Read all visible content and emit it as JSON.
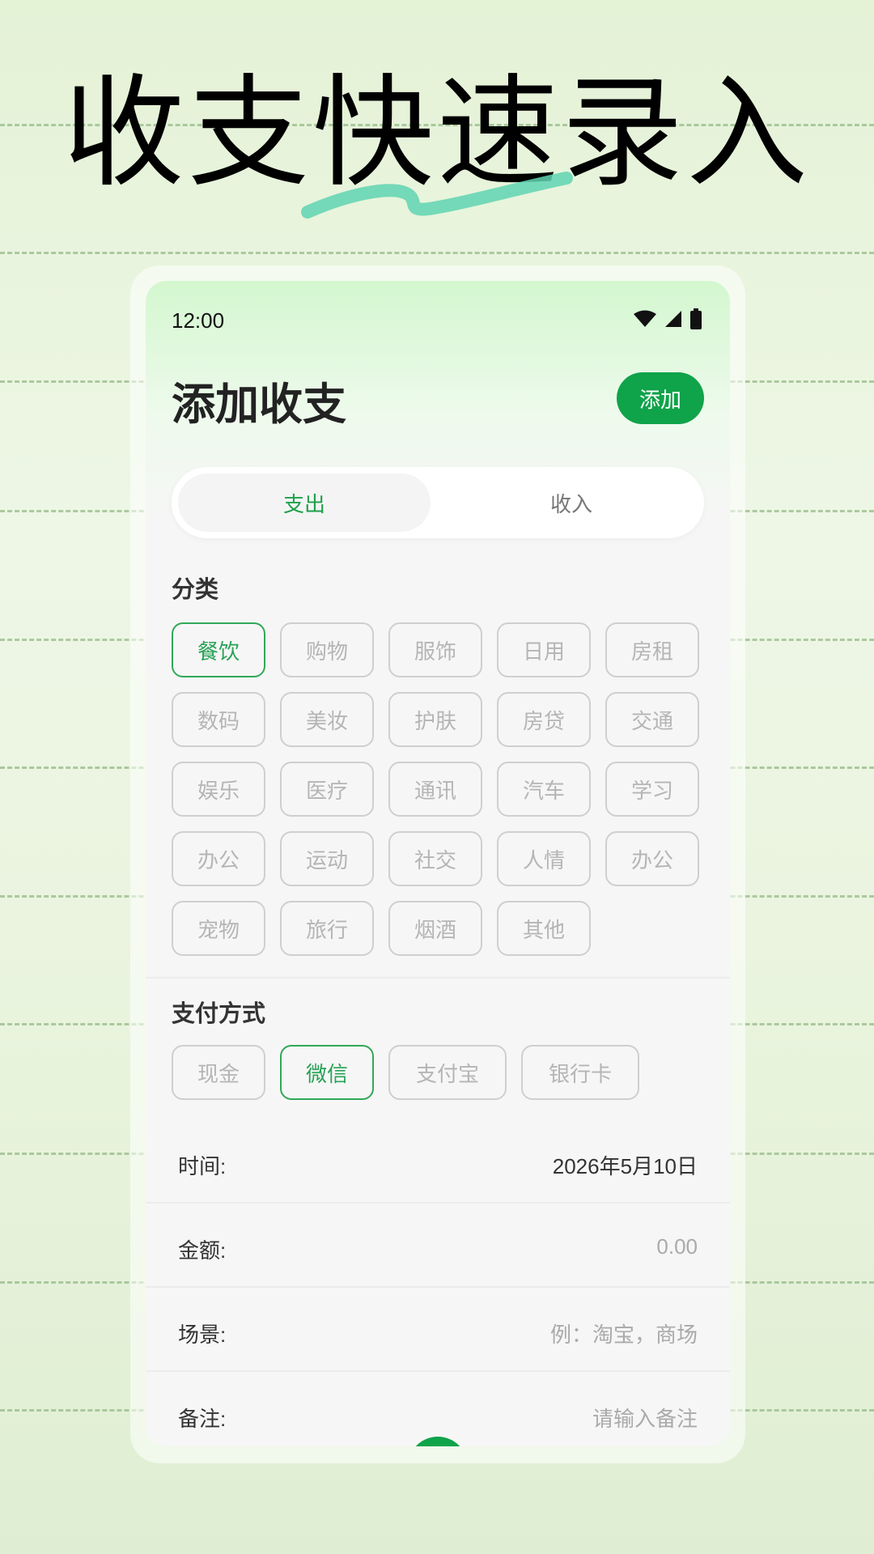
{
  "headline": "收支快速录入",
  "status": {
    "time": "12:00"
  },
  "header": {
    "title": "添加收支",
    "add_button": "添加"
  },
  "tabs": [
    {
      "label": "支出",
      "active": true
    },
    {
      "label": "收入",
      "active": false
    }
  ],
  "category_section": {
    "label": "分类",
    "items": [
      "餐饮",
      "购物",
      "服饰",
      "日用",
      "房租",
      "数码",
      "美妆",
      "护肤",
      "房贷",
      "交通",
      "娱乐",
      "医疗",
      "通讯",
      "汽车",
      "学习",
      "办公",
      "运动",
      "社交",
      "人情",
      "办公",
      "宠物",
      "旅行",
      "烟酒",
      "其他"
    ],
    "selected": "餐饮"
  },
  "payment_section": {
    "label": "支付方式",
    "items": [
      "现金",
      "微信",
      "支付宝",
      "银行卡"
    ],
    "selected": "微信"
  },
  "fields": {
    "time": {
      "label": "时间:",
      "value": "2026年5月10日"
    },
    "amount": {
      "label": "金额:",
      "placeholder": "0.00"
    },
    "scene": {
      "label": "场景:",
      "placeholder": "例：淘宝，商场"
    },
    "note": {
      "label": "备注:",
      "placeholder": "请输入备注"
    }
  },
  "colors": {
    "accent": "#0fa34a",
    "selected_text": "#27a255",
    "muted": "#b5b5b5"
  },
  "icons": [
    "wifi-icon",
    "signal-icon",
    "battery-icon"
  ]
}
